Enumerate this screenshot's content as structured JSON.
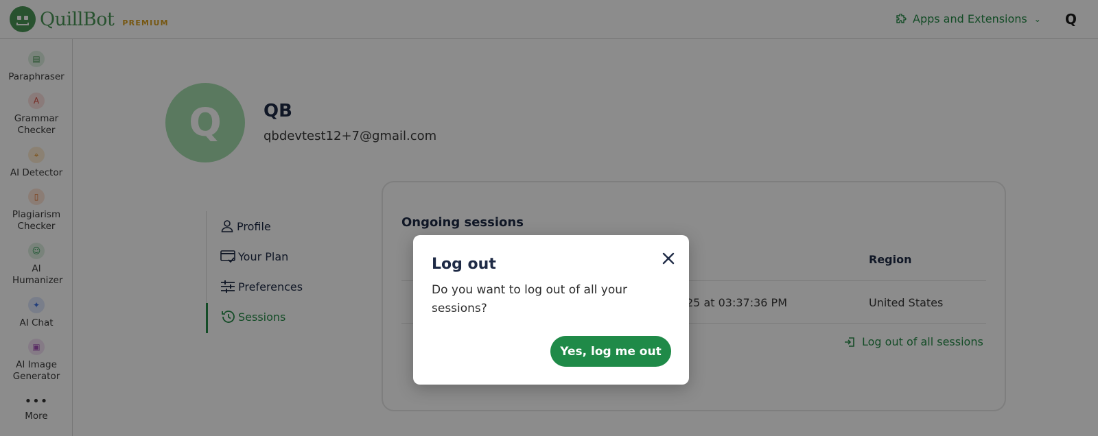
{
  "brand": {
    "name": "QuillBot",
    "tier": "PREMIUM",
    "accent": "#499557",
    "premium_color": "#d89f1f"
  },
  "header": {
    "apps_label": "Apps and Extensions",
    "avatar_letter": "Q"
  },
  "sidebar": {
    "items": [
      {
        "label": "Paraphraser",
        "icon": "paraphraser-icon"
      },
      {
        "label": "Grammar Checker",
        "icon": "grammar-checker-icon"
      },
      {
        "label": "AI Detector",
        "icon": "ai-detector-icon"
      },
      {
        "label": "Plagiarism Checker",
        "icon": "plagiarism-checker-icon"
      },
      {
        "label": "AI Humanizer",
        "icon": "ai-humanizer-icon"
      },
      {
        "label": "AI Chat",
        "icon": "ai-chat-icon"
      },
      {
        "label": "AI Image Generator",
        "icon": "ai-image-generator-icon"
      },
      {
        "label": "More",
        "icon": "more-icon"
      }
    ]
  },
  "profile": {
    "initial": "Q",
    "name": "QB",
    "email": "qbdevtest12+7@gmail.com"
  },
  "settings_nav": {
    "items": [
      {
        "label": "Profile",
        "icon": "person-icon"
      },
      {
        "label": "Your Plan",
        "icon": "credit-card-icon"
      },
      {
        "label": "Preferences",
        "icon": "sliders-icon"
      },
      {
        "label": "Sessions",
        "icon": "history-icon",
        "active": true
      }
    ]
  },
  "sessions": {
    "title": "Ongoing sessions",
    "columns": {
      "region": "Region"
    },
    "rows": [
      {
        "time_fragment": "25 at 03:37:36 PM",
        "region": "United States"
      }
    ],
    "logout_all_label": "Log out of all sessions"
  },
  "modal": {
    "title": "Log out",
    "body": "Do you want to log out of all your sessions?",
    "confirm_label": "Yes, log me out",
    "confirm_color": "#1f8a48"
  }
}
